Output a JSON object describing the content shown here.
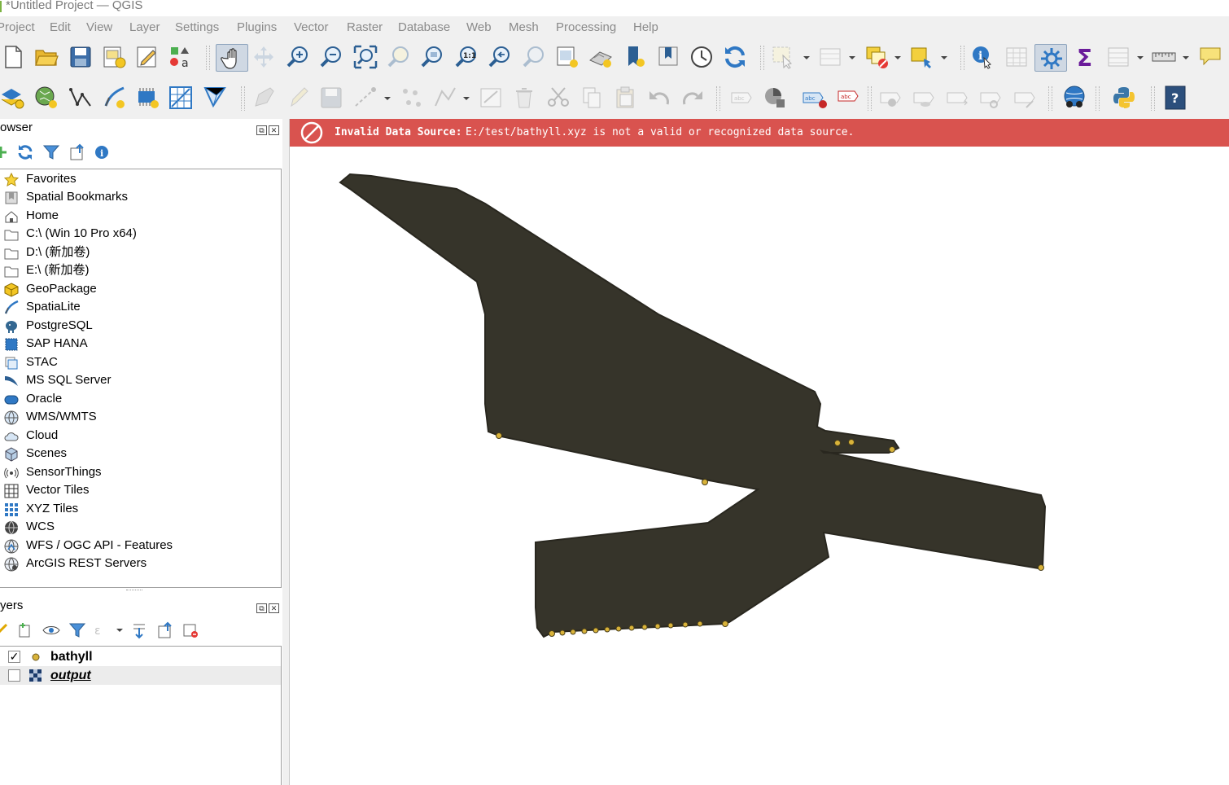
{
  "window": {
    "title": "*Untitled Project — QGIS"
  },
  "menu": [
    "Project",
    "Edit",
    "View",
    "Layer",
    "Settings",
    "Plugins",
    "Vector",
    "Raster",
    "Database",
    "Web",
    "Mesh",
    "Processing",
    "Help"
  ],
  "toolbar1": [
    {
      "icon": "new-project-icon"
    },
    {
      "icon": "open-project-icon"
    },
    {
      "icon": "save-project-icon"
    },
    {
      "icon": "new-print-layout-icon"
    },
    {
      "icon": "layout-manager-icon"
    },
    {
      "icon": "style-manager-icon"
    },
    {
      "icon": "pan-icon",
      "active": true
    },
    {
      "icon": "pan-to-selection-icon",
      "disabled": true
    },
    {
      "icon": "zoom-in-icon"
    },
    {
      "icon": "zoom-out-icon"
    },
    {
      "icon": "zoom-full-icon"
    },
    {
      "icon": "zoom-to-selection-icon",
      "disabled": true
    },
    {
      "icon": "zoom-to-layer-icon"
    },
    {
      "icon": "zoom-native-resolution-icon"
    },
    {
      "icon": "zoom-last-icon"
    },
    {
      "icon": "zoom-next-icon",
      "disabled": true
    },
    {
      "icon": "new-map-view-icon"
    },
    {
      "icon": "new-3d-map-view-icon"
    },
    {
      "icon": "new-bookmark-icon"
    },
    {
      "icon": "show-bookmarks-icon"
    },
    {
      "icon": "temporal-controller-icon"
    },
    {
      "icon": "refresh-icon"
    },
    {
      "icon": "select-features-icon"
    },
    {
      "icon": "select-by-value-icon",
      "disabled": true
    },
    {
      "icon": "deselect-features-icon"
    },
    {
      "icon": "filter-features-icon"
    },
    {
      "icon": "identify-features-icon"
    },
    {
      "icon": "attribute-table-icon",
      "disabled": true
    },
    {
      "icon": "toolbox-icon",
      "active": true
    },
    {
      "icon": "statistical-summary-icon"
    },
    {
      "icon": "field-calculator-icon",
      "disabled": true
    },
    {
      "icon": "measure-line-icon"
    },
    {
      "icon": "map-tips-icon"
    }
  ],
  "toolbar2": [
    {
      "icon": "data-source-manager-icon"
    },
    {
      "icon": "new-geopackage-layer-icon"
    },
    {
      "icon": "new-shapefile-layer-icon"
    },
    {
      "icon": "new-spatialite-layer-icon"
    },
    {
      "icon": "new-temporary-layer-icon"
    },
    {
      "icon": "new-virtual-layer-icon"
    },
    {
      "icon": "new-mesh-layer-icon"
    },
    {
      "icon": "current-edits-icon",
      "disabled": true
    },
    {
      "icon": "toggle-editing-icon",
      "disabled": true
    },
    {
      "icon": "save-edits-icon",
      "disabled": true
    },
    {
      "icon": "digitize-icon",
      "disabled": true
    },
    {
      "icon": "vertex-tool-icon",
      "disabled": true
    },
    {
      "icon": "modify-attributes-icon",
      "disabled": true
    },
    {
      "icon": "delete-selected-icon",
      "disabled": true
    },
    {
      "icon": "cut-features-icon",
      "disabled": true
    },
    {
      "icon": "copy-features-icon",
      "disabled": true
    },
    {
      "icon": "paste-features-icon",
      "disabled": true
    },
    {
      "icon": "undo-icon",
      "disabled": true
    },
    {
      "icon": "redo-icon",
      "disabled": true
    },
    {
      "icon": "label-toolbar-icon",
      "disabled": true
    },
    {
      "icon": "diagram-toolbar-icon"
    },
    {
      "icon": "highlight-pinned-labels-icon"
    },
    {
      "icon": "pin-labels-icon"
    },
    {
      "icon": "show-hide-labels-icon",
      "disabled": true
    },
    {
      "icon": "move-label-icon",
      "disabled": true
    },
    {
      "icon": "rotate-label-icon",
      "disabled": true
    },
    {
      "icon": "change-label-icon",
      "disabled": true
    },
    {
      "icon": "metasearch-icon"
    },
    {
      "icon": "python-console-icon"
    },
    {
      "icon": "help-icon"
    }
  ],
  "browser": {
    "title": "owser",
    "items": [
      {
        "label": "Favorites",
        "icon": "star-icon"
      },
      {
        "label": "Spatial Bookmarks",
        "icon": "bookmark-icon"
      },
      {
        "label": "Home",
        "icon": "home-icon"
      },
      {
        "label": "C:\\ (Win 10 Pro x64)",
        "icon": "folder-icon"
      },
      {
        "label": "D:\\ (新加卷)",
        "icon": "folder-icon"
      },
      {
        "label": "E:\\ (新加卷)",
        "icon": "folder-icon"
      },
      {
        "label": "GeoPackage",
        "icon": "geopackage-icon"
      },
      {
        "label": "SpatiaLite",
        "icon": "spatialite-icon"
      },
      {
        "label": "PostgreSQL",
        "icon": "postgresql-icon"
      },
      {
        "label": "SAP HANA",
        "icon": "sap-hana-icon"
      },
      {
        "label": "STAC",
        "icon": "stac-icon"
      },
      {
        "label": "MS SQL Server",
        "icon": "mssql-icon"
      },
      {
        "label": "Oracle",
        "icon": "oracle-icon"
      },
      {
        "label": "WMS/WMTS",
        "icon": "wms-icon"
      },
      {
        "label": "Cloud",
        "icon": "cloud-icon"
      },
      {
        "label": "Scenes",
        "icon": "scenes-icon"
      },
      {
        "label": "SensorThings",
        "icon": "sensorthings-icon"
      },
      {
        "label": "Vector Tiles",
        "icon": "vector-tiles-icon"
      },
      {
        "label": "XYZ Tiles",
        "icon": "xyz-tiles-icon"
      },
      {
        "label": "WCS",
        "icon": "wcs-icon"
      },
      {
        "label": "WFS / OGC API - Features",
        "icon": "wfs-icon"
      },
      {
        "label": "ArcGIS REST Servers",
        "icon": "arcgis-icon"
      }
    ]
  },
  "layers": {
    "title": "yers",
    "items": [
      {
        "label": "bathyll",
        "checked": true,
        "icon": "point-layer-icon"
      },
      {
        "label": "output",
        "checked": false,
        "icon": "raster-layer-icon"
      }
    ]
  },
  "message": {
    "title": "Invalid Data Source:",
    "text": "E:/test/bathyll.xyz is not a valid or recognized data source."
  },
  "colors": {
    "message_bg": "#d9534f",
    "feature_fill": "#36342a",
    "point_fill": "#d9b33a",
    "toolbar_bg": "#f0f0f0"
  }
}
